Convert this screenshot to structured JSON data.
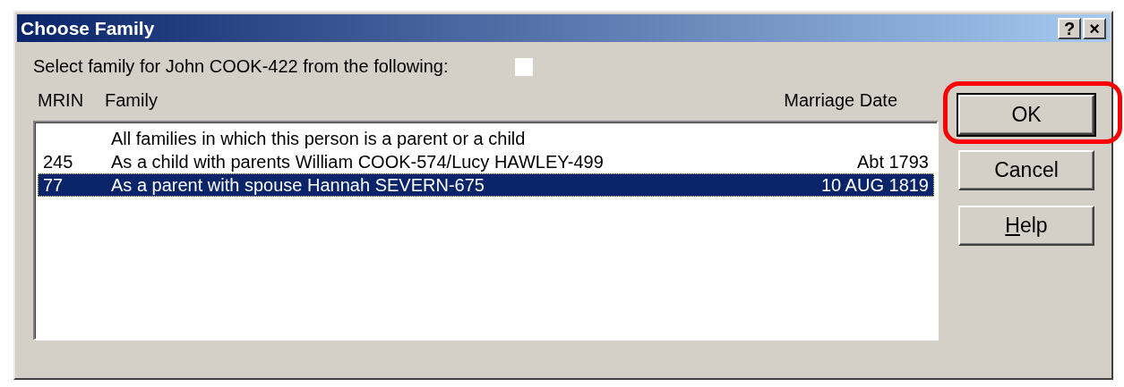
{
  "window": {
    "title": "Choose Family",
    "title_buttons": [
      "?",
      "×"
    ]
  },
  "prompt": "Select family for John COOK-422 from the following:",
  "columns": [
    "MRIN",
    "Family",
    "Marriage Date"
  ],
  "rows": [
    {
      "family": "All families in which this person is a parent or a child",
      "selected": false
    },
    {
      "mrin": "245",
      "family": "As a child with parents William COOK-574/Lucy HAWLEY-499",
      "date": "Abt 1793",
      "selected": false
    },
    {
      "mrin": "77",
      "family": "As a parent with spouse Hannah SEVERN-675",
      "date": "10 AUG 1819",
      "selected": true
    }
  ],
  "buttons": [
    {
      "label": "OK",
      "default": true,
      "highlighted": true
    },
    {
      "label": "Cancel",
      "default": false,
      "highlighted": false
    },
    {
      "label": "Help",
      "default": false,
      "highlighted": false,
      "mnemonic": true
    }
  ]
}
